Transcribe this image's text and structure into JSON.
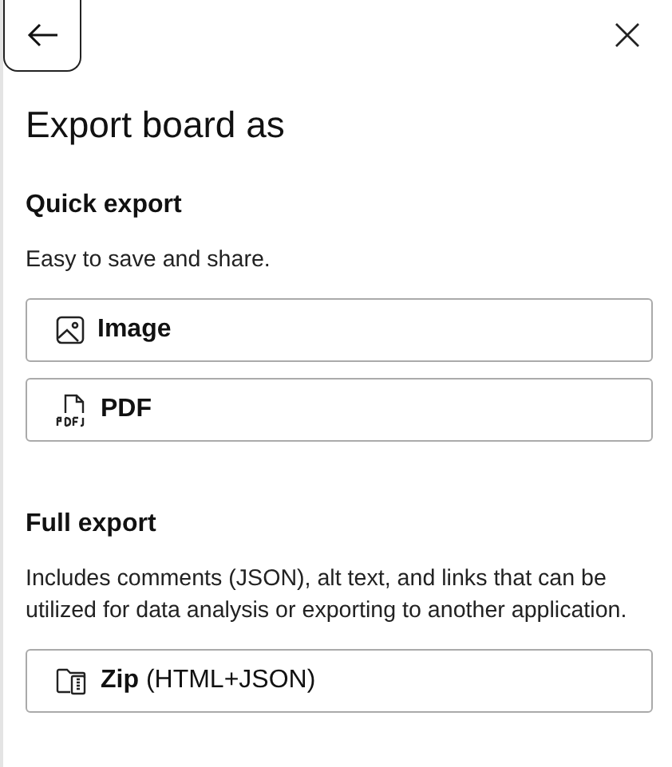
{
  "title": "Export board as",
  "sections": [
    {
      "heading": "Quick export",
      "description": "Easy to save and share.",
      "options": [
        {
          "kind": "image",
          "label": "Image"
        },
        {
          "kind": "pdf",
          "label": "PDF"
        }
      ]
    },
    {
      "heading": "Full export",
      "description": "Includes comments (JSON), alt text, and links that can be utilized for data analysis or exporting to another application.",
      "options": [
        {
          "kind": "zip",
          "label": "**Zip** (HTML+JSON)"
        }
      ]
    }
  ]
}
